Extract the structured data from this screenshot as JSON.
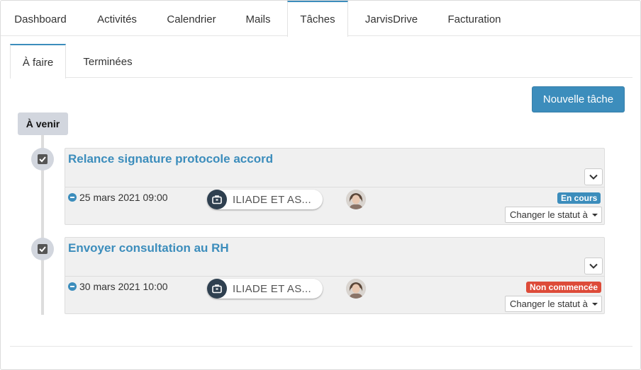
{
  "main_tabs": [
    {
      "label": "Dashboard",
      "active": false
    },
    {
      "label": "Activités",
      "active": false
    },
    {
      "label": "Calendrier",
      "active": false
    },
    {
      "label": "Mails",
      "active": false
    },
    {
      "label": "Tâches",
      "active": true
    },
    {
      "label": "JarvisDrive",
      "active": false
    },
    {
      "label": "Facturation",
      "active": false
    }
  ],
  "sub_tabs": [
    {
      "label": "À faire",
      "active": true
    },
    {
      "label": "Terminées",
      "active": false
    }
  ],
  "new_task_label": "Nouvelle tâche",
  "timeline_label": "À venir",
  "tasks": [
    {
      "title": "Relance signature protocole accord",
      "date": "25 mars 2021 09:00",
      "client": "ILIADE ET AS...",
      "status": "En cours",
      "status_color": "#3c8dbc",
      "status_action": "Changer le statut à"
    },
    {
      "title": "Envoyer consultation au RH",
      "date": "30 mars 2021 10:00",
      "client": "ILIADE ET AS...",
      "status": "Non commencée",
      "status_color": "#dd4b39",
      "status_action": "Changer le statut à"
    }
  ],
  "colors": {
    "accent": "#3c8dbc",
    "label_bg": "#d2d6de",
    "danger": "#dd4b39",
    "chip_icon": "#2f4050"
  }
}
